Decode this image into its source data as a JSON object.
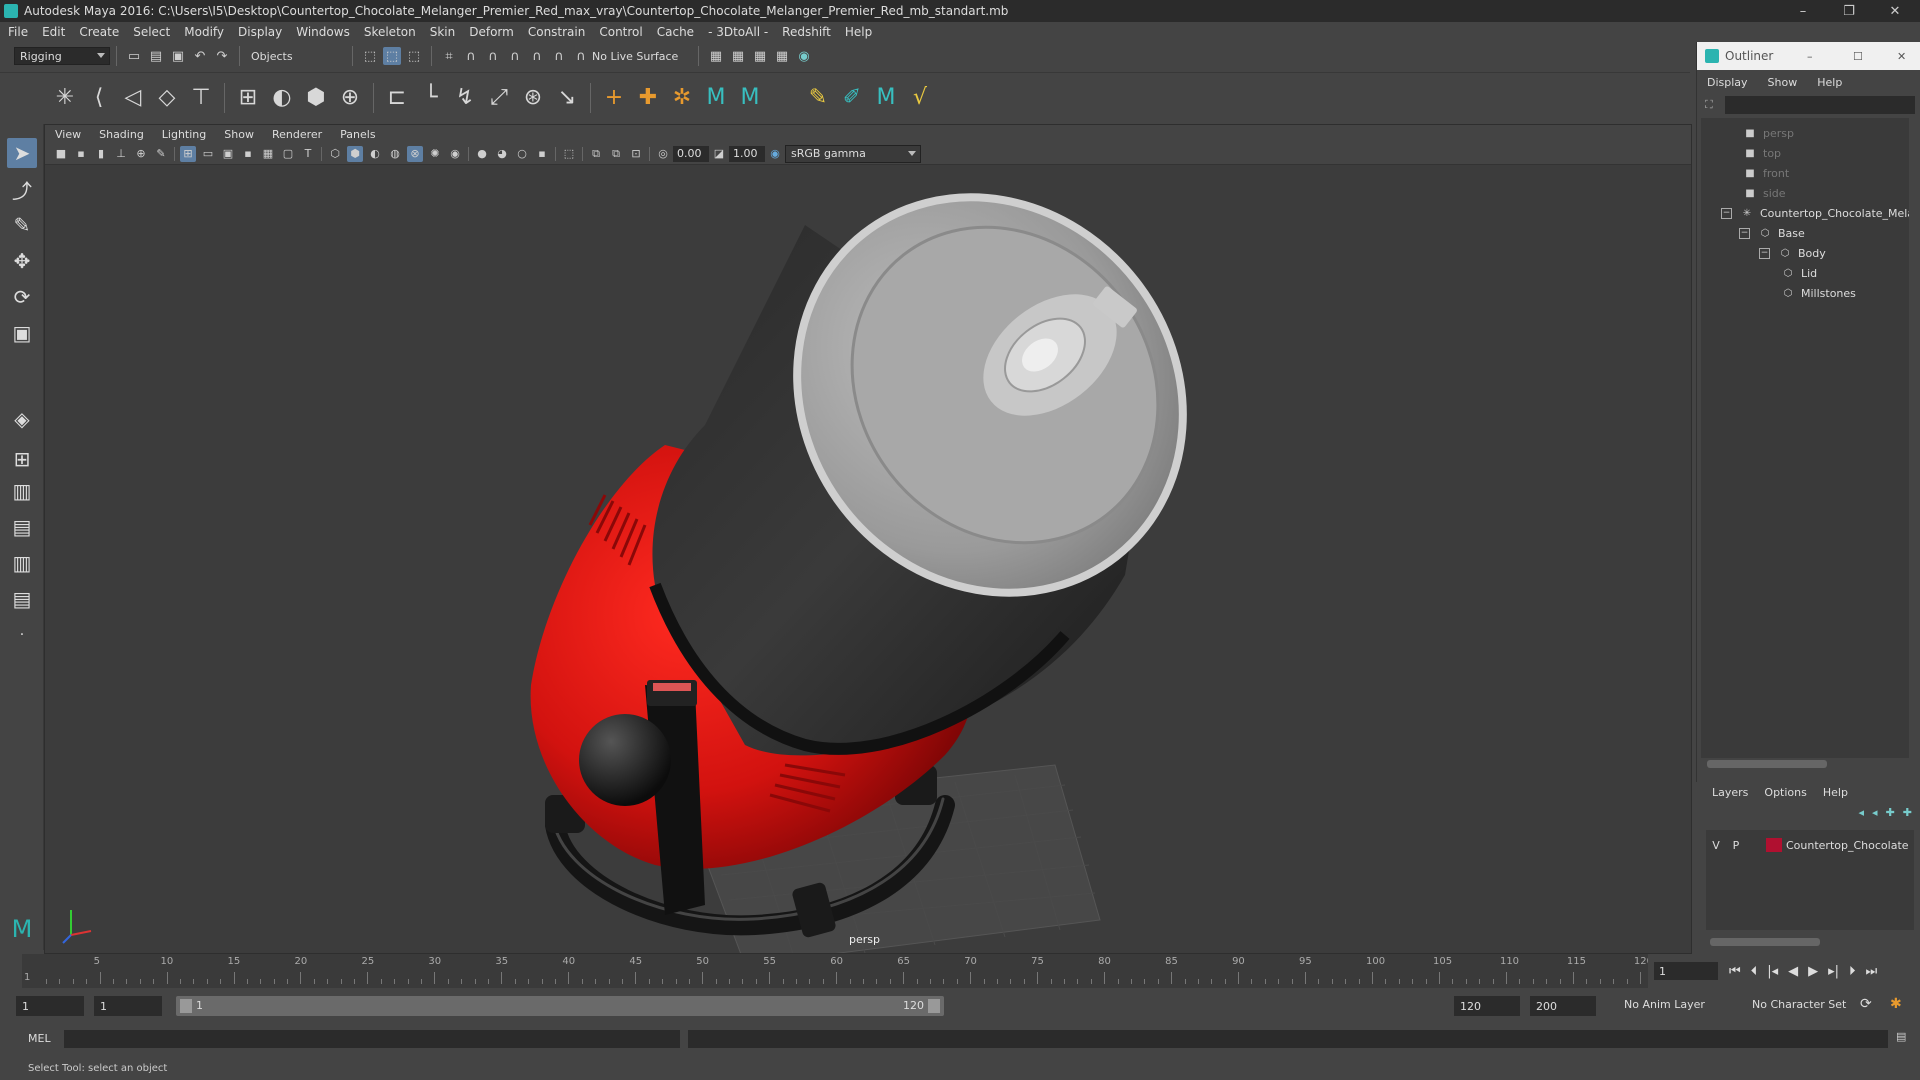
{
  "window": {
    "title": "Autodesk Maya 2016: C:\\Users\\I5\\Desktop\\Countertop_Chocolate_Melanger_Premier_Red_max_vray\\Countertop_Chocolate_Melanger_Premier_Red_mb_standart.mb",
    "controls": {
      "minimize": "–",
      "restore": "❐",
      "close": "✕"
    }
  },
  "menubar": [
    "File",
    "Edit",
    "Create",
    "Select",
    "Modify",
    "Display",
    "Windows",
    "Skeleton",
    "Skin",
    "Deform",
    "Constrain",
    "Control",
    "Cache",
    "- 3DtoAll -",
    "Redshift",
    "Help"
  ],
  "statusline": {
    "menuset": "Rigging",
    "select_mode": "Objects",
    "live_surface": "No Live Surface"
  },
  "viewport": {
    "menu": [
      "View",
      "Shading",
      "Lighting",
      "Show",
      "Renderer",
      "Panels"
    ],
    "exposure": "0.00",
    "gamma": "1.00",
    "color_space": "sRGB gamma",
    "camera_label": "persp"
  },
  "outliner": {
    "title": "Outliner",
    "menu": [
      "Display",
      "Show",
      "Help"
    ],
    "items": [
      {
        "label": "persp",
        "icon": "camera-icon"
      },
      {
        "label": "top",
        "icon": "camera-icon"
      },
      {
        "label": "front",
        "icon": "camera-icon"
      },
      {
        "label": "side",
        "icon": "camera-icon"
      },
      {
        "label": "Countertop_Chocolate_Mela",
        "icon": "group-icon"
      },
      {
        "label": "Base",
        "icon": "mesh-icon"
      },
      {
        "label": "Body",
        "icon": "mesh-icon"
      },
      {
        "label": "Lid",
        "icon": "mesh-icon"
      },
      {
        "label": "Millstones",
        "icon": "mesh-icon"
      }
    ]
  },
  "layers": {
    "menu": [
      "Layers",
      "Options",
      "Help"
    ],
    "row": {
      "v": "V",
      "p": "P",
      "name": "Countertop_Chocolate",
      "color": "#b01030"
    }
  },
  "timeslider": {
    "ticks": [
      "5",
      "10",
      "15",
      "20",
      "25",
      "30",
      "35",
      "40",
      "45",
      "50",
      "55",
      "60",
      "65",
      "70",
      "75",
      "80",
      "85",
      "90",
      "95",
      "100",
      "105",
      "110",
      "115",
      "120"
    ],
    "current_frame_label": "1",
    "current_frame_field": "1"
  },
  "range": {
    "start": "1",
    "playback_start": "1",
    "slider_start": "1",
    "slider_end": "120",
    "playback_end": "120",
    "end": "200",
    "anim_layer": "No Anim Layer",
    "char_set": "No Character Set"
  },
  "mel": {
    "label": "MEL"
  },
  "helpline": {
    "text": "Select Tool: select an object"
  },
  "colors": {
    "accent": "#5e7fa3",
    "body_red": "#d2120f",
    "maya_teal": "#2bb4b0"
  }
}
